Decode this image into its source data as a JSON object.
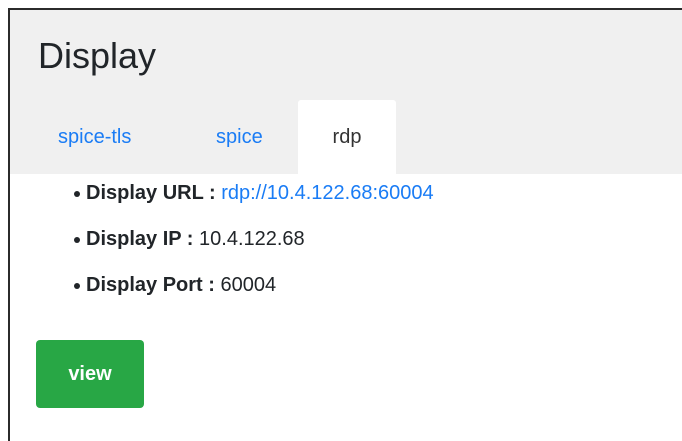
{
  "panel": {
    "title": "Display"
  },
  "tabs": [
    {
      "label": "spice-tls",
      "active": false
    },
    {
      "label": "spice",
      "active": false
    },
    {
      "label": "rdp",
      "active": true
    }
  ],
  "info": {
    "url": {
      "key": "Display URL :",
      "value": "rdp://10.4.122.68:60004"
    },
    "ip": {
      "key": "Display IP :",
      "value": "10.4.122.68"
    },
    "port": {
      "key": "Display Port :",
      "value": "60004"
    }
  },
  "actions": {
    "view_label": "view"
  },
  "colors": {
    "link": "#1a7cf5",
    "button": "#28a745",
    "header_bg": "#f0f0f0"
  }
}
